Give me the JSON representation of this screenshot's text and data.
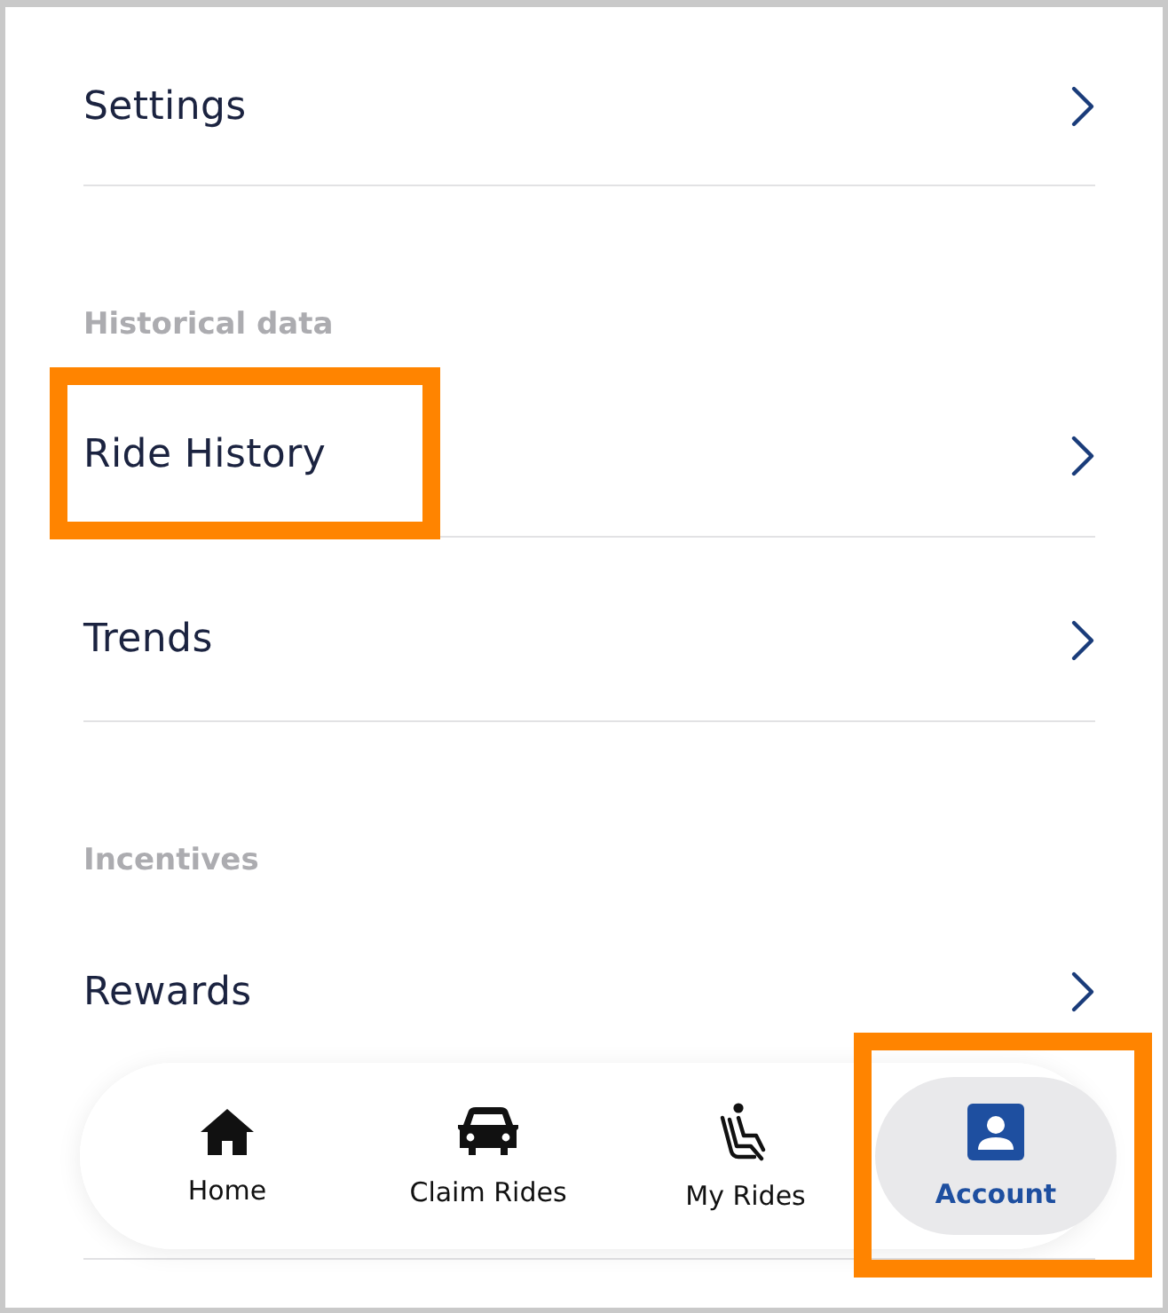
{
  "sections": [
    {
      "items": [
        {
          "label": "Settings",
          "highlighted": false
        }
      ]
    },
    {
      "heading": "Historical data",
      "items": [
        {
          "label": "Ride History",
          "highlighted": true
        },
        {
          "label": "Trends",
          "highlighted": false
        }
      ]
    },
    {
      "heading": "Incentives",
      "items": [
        {
          "label": "Rewards",
          "highlighted": false
        }
      ]
    }
  ],
  "bottom_nav": [
    {
      "kind": "home",
      "label": "Home",
      "selected": false,
      "highlighted": false
    },
    {
      "kind": "car",
      "label": "Claim Rides",
      "selected": false,
      "highlighted": false
    },
    {
      "kind": "seat",
      "label": "My Rides",
      "selected": false,
      "highlighted": false
    },
    {
      "kind": "account",
      "label": "Account",
      "selected": true,
      "highlighted": true
    }
  ]
}
